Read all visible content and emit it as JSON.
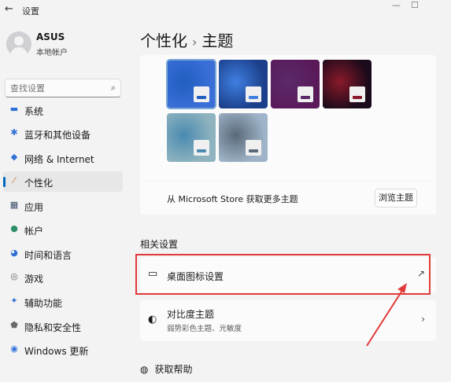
{
  "window": {
    "title": "设置",
    "back_glyph": "←",
    "min_glyph": "—",
    "max_glyph": "☐"
  },
  "user": {
    "name": "ASUS",
    "account_type": "本地帐户"
  },
  "search": {
    "placeholder": "查找设置",
    "icon": "search-icon"
  },
  "nav": [
    {
      "label": "系统",
      "icon": "system-icon",
      "glyph": "▬",
      "color": "#2f6fd6"
    },
    {
      "label": "蓝牙和其他设备",
      "icon": "bluetooth-icon",
      "glyph": "✱",
      "color": "#2f6fd6"
    },
    {
      "label": "网络 & Internet",
      "icon": "wifi-icon",
      "glyph": "◆",
      "color": "#2f6fd6"
    },
    {
      "label": "个性化",
      "icon": "brush-icon",
      "glyph": "⁄",
      "color": "#c07a3a",
      "active": true
    },
    {
      "label": "应用",
      "icon": "apps-icon",
      "glyph": "▦",
      "color": "#3a4a6a"
    },
    {
      "label": "帐户",
      "icon": "account-icon",
      "glyph": "●",
      "color": "#2f8f6a"
    },
    {
      "label": "时间和语言",
      "icon": "clock-globe-icon",
      "glyph": "◕",
      "color": "#2f6fd6"
    },
    {
      "label": "游戏",
      "icon": "gaming-icon",
      "glyph": "◎",
      "color": "#6a6a6a"
    },
    {
      "label": "辅助功能",
      "icon": "accessibility-icon",
      "glyph": "✦",
      "color": "#2f6fd6"
    },
    {
      "label": "隐私和安全性",
      "icon": "shield-icon",
      "glyph": "⬟",
      "color": "#6a6a6a"
    },
    {
      "label": "Windows 更新",
      "icon": "update-icon",
      "glyph": "◉",
      "color": "#2f6fd6"
    }
  ],
  "breadcrumb": {
    "parent": "个性化",
    "separator": "›",
    "current": "主题"
  },
  "themes": [
    {
      "name": "theme-windows-light",
      "bg": "#3b6fd8",
      "accent": "#1f5fbf",
      "selected": true
    },
    {
      "name": "theme-windows-dark",
      "bg": "#1b3f8a",
      "accent": "#3f7fe0",
      "selected": false
    },
    {
      "name": "theme-glow",
      "bg": "#5a1a5a",
      "accent": "#5a2a6a",
      "selected": false
    },
    {
      "name": "theme-captured-motion",
      "bg": "#1a0a1a",
      "accent": "#8a1a2a",
      "selected": false
    },
    {
      "name": "theme-sunrise-lake",
      "bg": "#8fb4bf",
      "accent": "#4a8ab0",
      "selected": false
    },
    {
      "name": "theme-flow",
      "bg": "#9fb4c8",
      "accent": "#5a6a7a",
      "selected": false
    }
  ],
  "store": {
    "text": "从 Microsoft Store 获取更多主题",
    "button": "浏览主题"
  },
  "related": {
    "title": "相关设置",
    "desktop_icons": {
      "label": "桌面图标设置",
      "trailing_glyph": "↗"
    },
    "contrast": {
      "label": "对比度主题",
      "sub": "弱势彩色主题、光敏度",
      "trailing_glyph": "›"
    }
  },
  "help": {
    "label": "获取帮助"
  },
  "colors": {
    "accent": "#0067c0",
    "annotation": "#e23a3a"
  }
}
